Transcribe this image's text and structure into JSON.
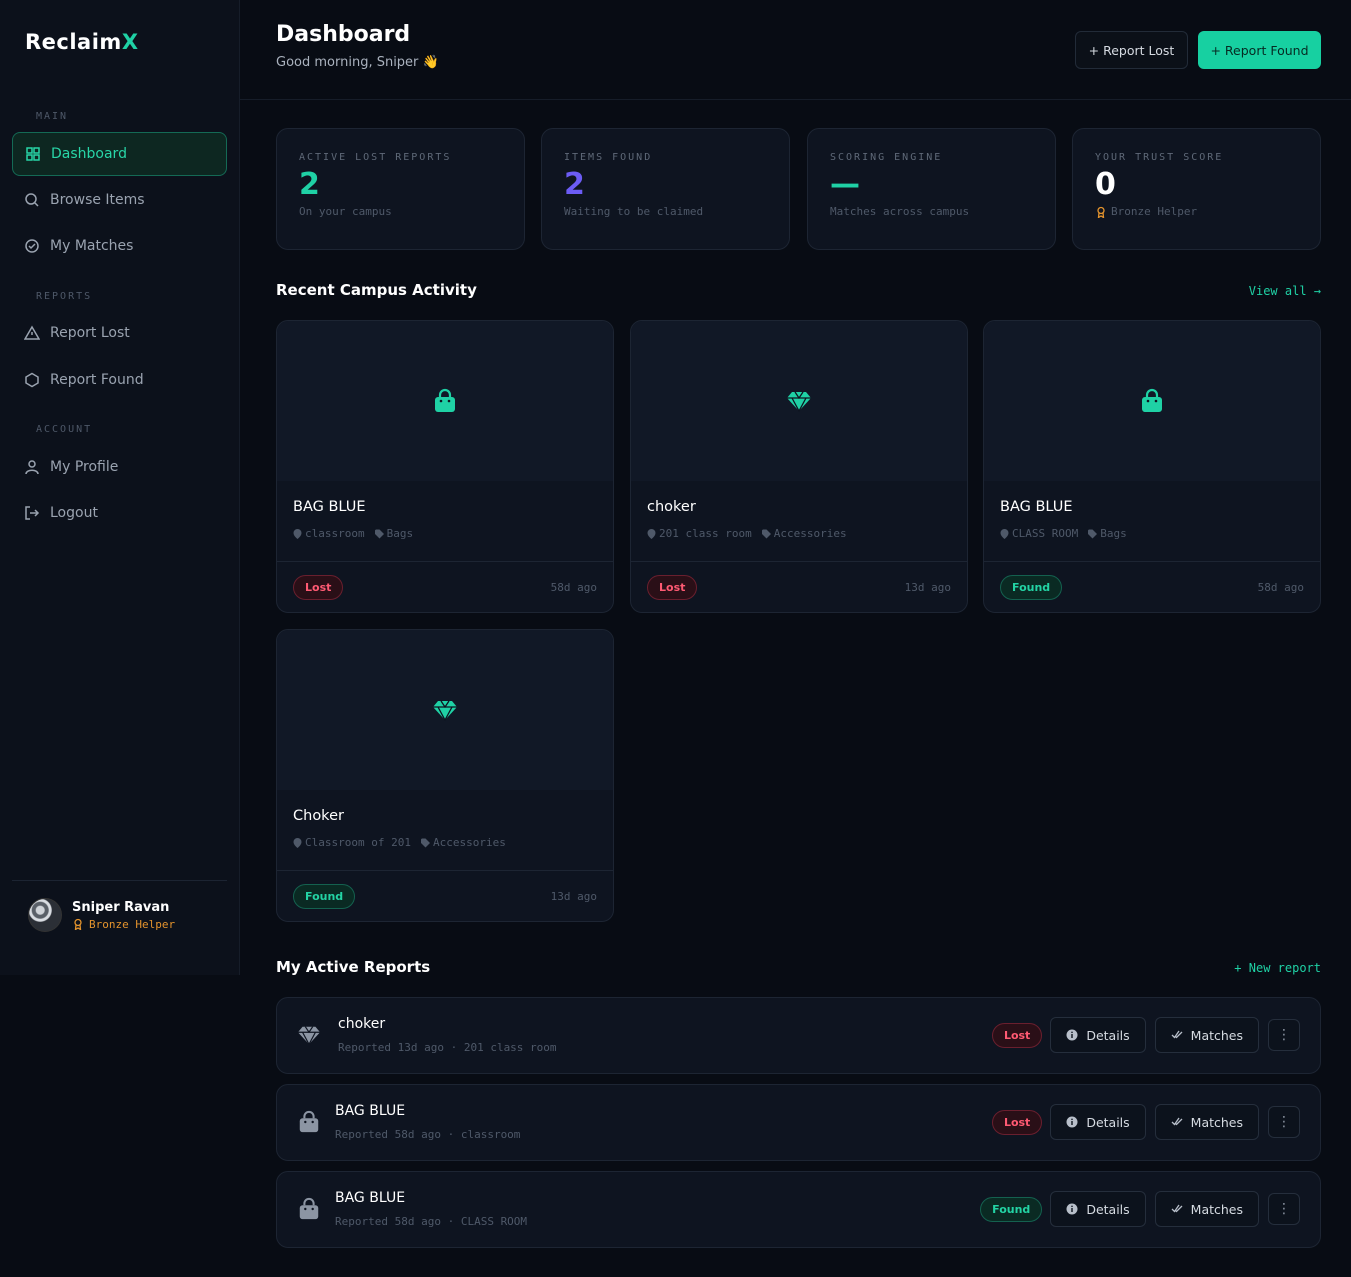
{
  "brand": {
    "name_main": "Reclaim",
    "name_accent": "X",
    "accent_color": "#1fd1a5"
  },
  "sidebar": {
    "sections": [
      {
        "label": "MAIN"
      },
      {
        "label": "REPORTS"
      },
      {
        "label": "ACCOUNT"
      }
    ],
    "items": [
      {
        "label": "Dashboard",
        "icon": "grid-icon",
        "active": true
      },
      {
        "label": "Browse Items",
        "icon": "search-icon"
      },
      {
        "label": "My Matches",
        "icon": "check-circle-icon"
      },
      {
        "label": "Report Lost",
        "icon": "alert-triangle-icon"
      },
      {
        "label": "Report Found",
        "icon": "hexagon-icon"
      },
      {
        "label": "My Profile",
        "icon": "user-icon"
      },
      {
        "label": "Logout",
        "icon": "logout-icon"
      }
    ],
    "user": {
      "name": "Sniper Ravan",
      "badge": "Bronze Helper"
    }
  },
  "header": {
    "title": "Dashboard",
    "greeting": "Good morning, Sniper 👋",
    "report_lost_label": "+ Report Lost",
    "report_found_label": "+ Report Found"
  },
  "stats": [
    {
      "label": "ACTIVE LOST REPORTS",
      "value": "2",
      "sub": "On your campus",
      "color": "#1fd1a5"
    },
    {
      "label": "ITEMS FOUND",
      "value": "2",
      "sub": "Waiting to be claimed",
      "color": "#6c5cf5"
    },
    {
      "label": "SCORING ENGINE",
      "value": "—",
      "sub": "Matches across campus",
      "color": "#1fd1a5"
    },
    {
      "label": "YOUR TRUST SCORE",
      "value": "0",
      "sub": "Bronze Helper",
      "color": "#ffffff"
    }
  ],
  "activity": {
    "title": "Recent Campus Activity",
    "view_all": "View all →",
    "items": [
      {
        "title": "BAG BLUE",
        "location": "classroom",
        "category": "Bags",
        "status": "Lost",
        "ago": "58d ago",
        "icon": "bag-icon"
      },
      {
        "title": "choker",
        "location": "201 class room",
        "category": "Accessories",
        "status": "Lost",
        "ago": "13d ago",
        "icon": "gem-icon"
      },
      {
        "title": "BAG BLUE",
        "location": "CLASS ROOM",
        "category": "Bags",
        "status": "Found",
        "ago": "58d ago",
        "icon": "bag-icon"
      },
      {
        "title": "Choker",
        "location": "Classroom of 201",
        "category": "Accessories",
        "status": "Found",
        "ago": "13d ago",
        "icon": "gem-icon"
      }
    ]
  },
  "reports": {
    "title": "My Active Reports",
    "new_report": "+ New report",
    "details_label": "Details",
    "matches_label": "Matches",
    "more_label": "⋮",
    "items": [
      {
        "title": "choker",
        "sub": "Reported 13d ago · 201 class room",
        "status": "Lost",
        "icon": "gem-icon"
      },
      {
        "title": "BAG BLUE",
        "sub": "Reported 58d ago · classroom",
        "status": "Lost",
        "icon": "bag-icon"
      },
      {
        "title": "BAG BLUE",
        "sub": "Reported 58d ago · CLASS ROOM",
        "status": "Found",
        "icon": "bag-icon"
      }
    ]
  }
}
